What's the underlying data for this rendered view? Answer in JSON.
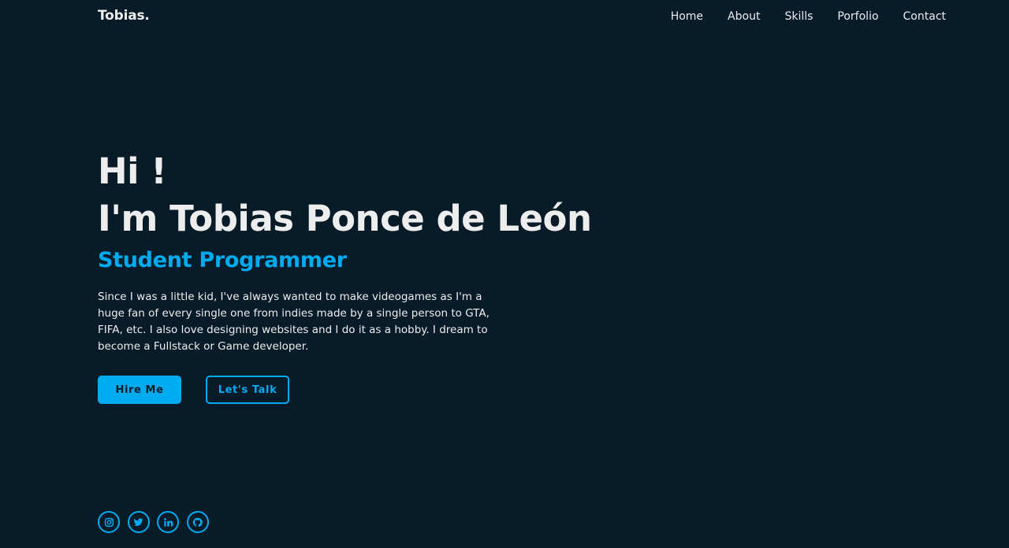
{
  "header": {
    "logo": "Tobias.",
    "nav": [
      {
        "label": "Home"
      },
      {
        "label": "About"
      },
      {
        "label": "Skills"
      },
      {
        "label": "Porfolio"
      },
      {
        "label": "Contact"
      }
    ]
  },
  "home": {
    "greeting": "Hi !",
    "name_line": "I'm Tobias Ponce de León",
    "role": "Student Programmer",
    "bio": "Since I was a little kid, I've always wanted to make videogames as I'm a huge fan of every single one from indies made by a single person to GTA, FIFA, etc. I also love designing websites and I do it as a hobby. I dream to become a Fullstack or Game developer.",
    "buttons": {
      "hire": "Hire Me",
      "talk": "Let's Talk"
    }
  },
  "social": [
    {
      "icon": "instagram-icon"
    },
    {
      "icon": "twitter-icon"
    },
    {
      "icon": "linkedin-icon"
    },
    {
      "icon": "github-icon"
    }
  ],
  "colors": {
    "background": "#081b29",
    "accent": "#00abf0",
    "text": "#ededed"
  }
}
